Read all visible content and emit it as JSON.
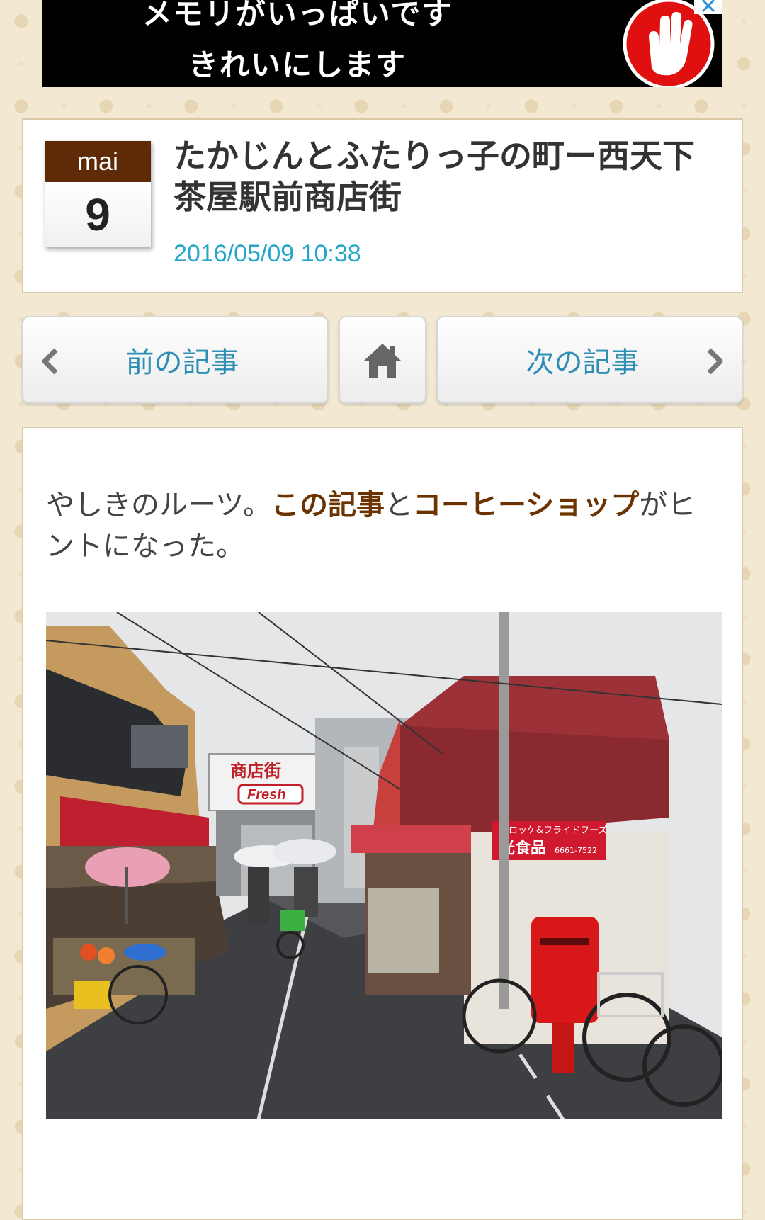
{
  "ad": {
    "line1": "メモリがいっぱいです",
    "line2": "きれいにします",
    "info_icon": "info-icon",
    "close_icon": "close-icon",
    "stop_icon": "stop-hand-icon"
  },
  "post": {
    "month": "mai",
    "day": "9",
    "title": "たかじんとふたりっ子の町ー西天下茶屋駅前商店街",
    "datetime": "2016/05/09 10:38"
  },
  "nav": {
    "prev_label": "前の記事",
    "next_label": "次の記事",
    "home_icon": "home-icon",
    "prev_icon": "chevron-left-icon",
    "next_icon": "chevron-right-icon"
  },
  "article": {
    "intro_part1": "やしきのルーツ。",
    "link1": "この記事",
    "intro_part2": "と",
    "link2": "コーヒーショップ",
    "intro_part3": "がヒントになった。",
    "photo_sign_top": "商店街",
    "photo_sign_brand": "Fresh",
    "photo_shop_sign_top": "コロッケ&フライドフーズ",
    "photo_shop_sign_main": "光食品",
    "photo_shop_phone": "6661-7522"
  },
  "colors": {
    "accent_brown": "#5e2a08",
    "link_brown": "#6a3300",
    "date_blue": "#25a6c9",
    "nav_blue": "#2e8fb5"
  }
}
